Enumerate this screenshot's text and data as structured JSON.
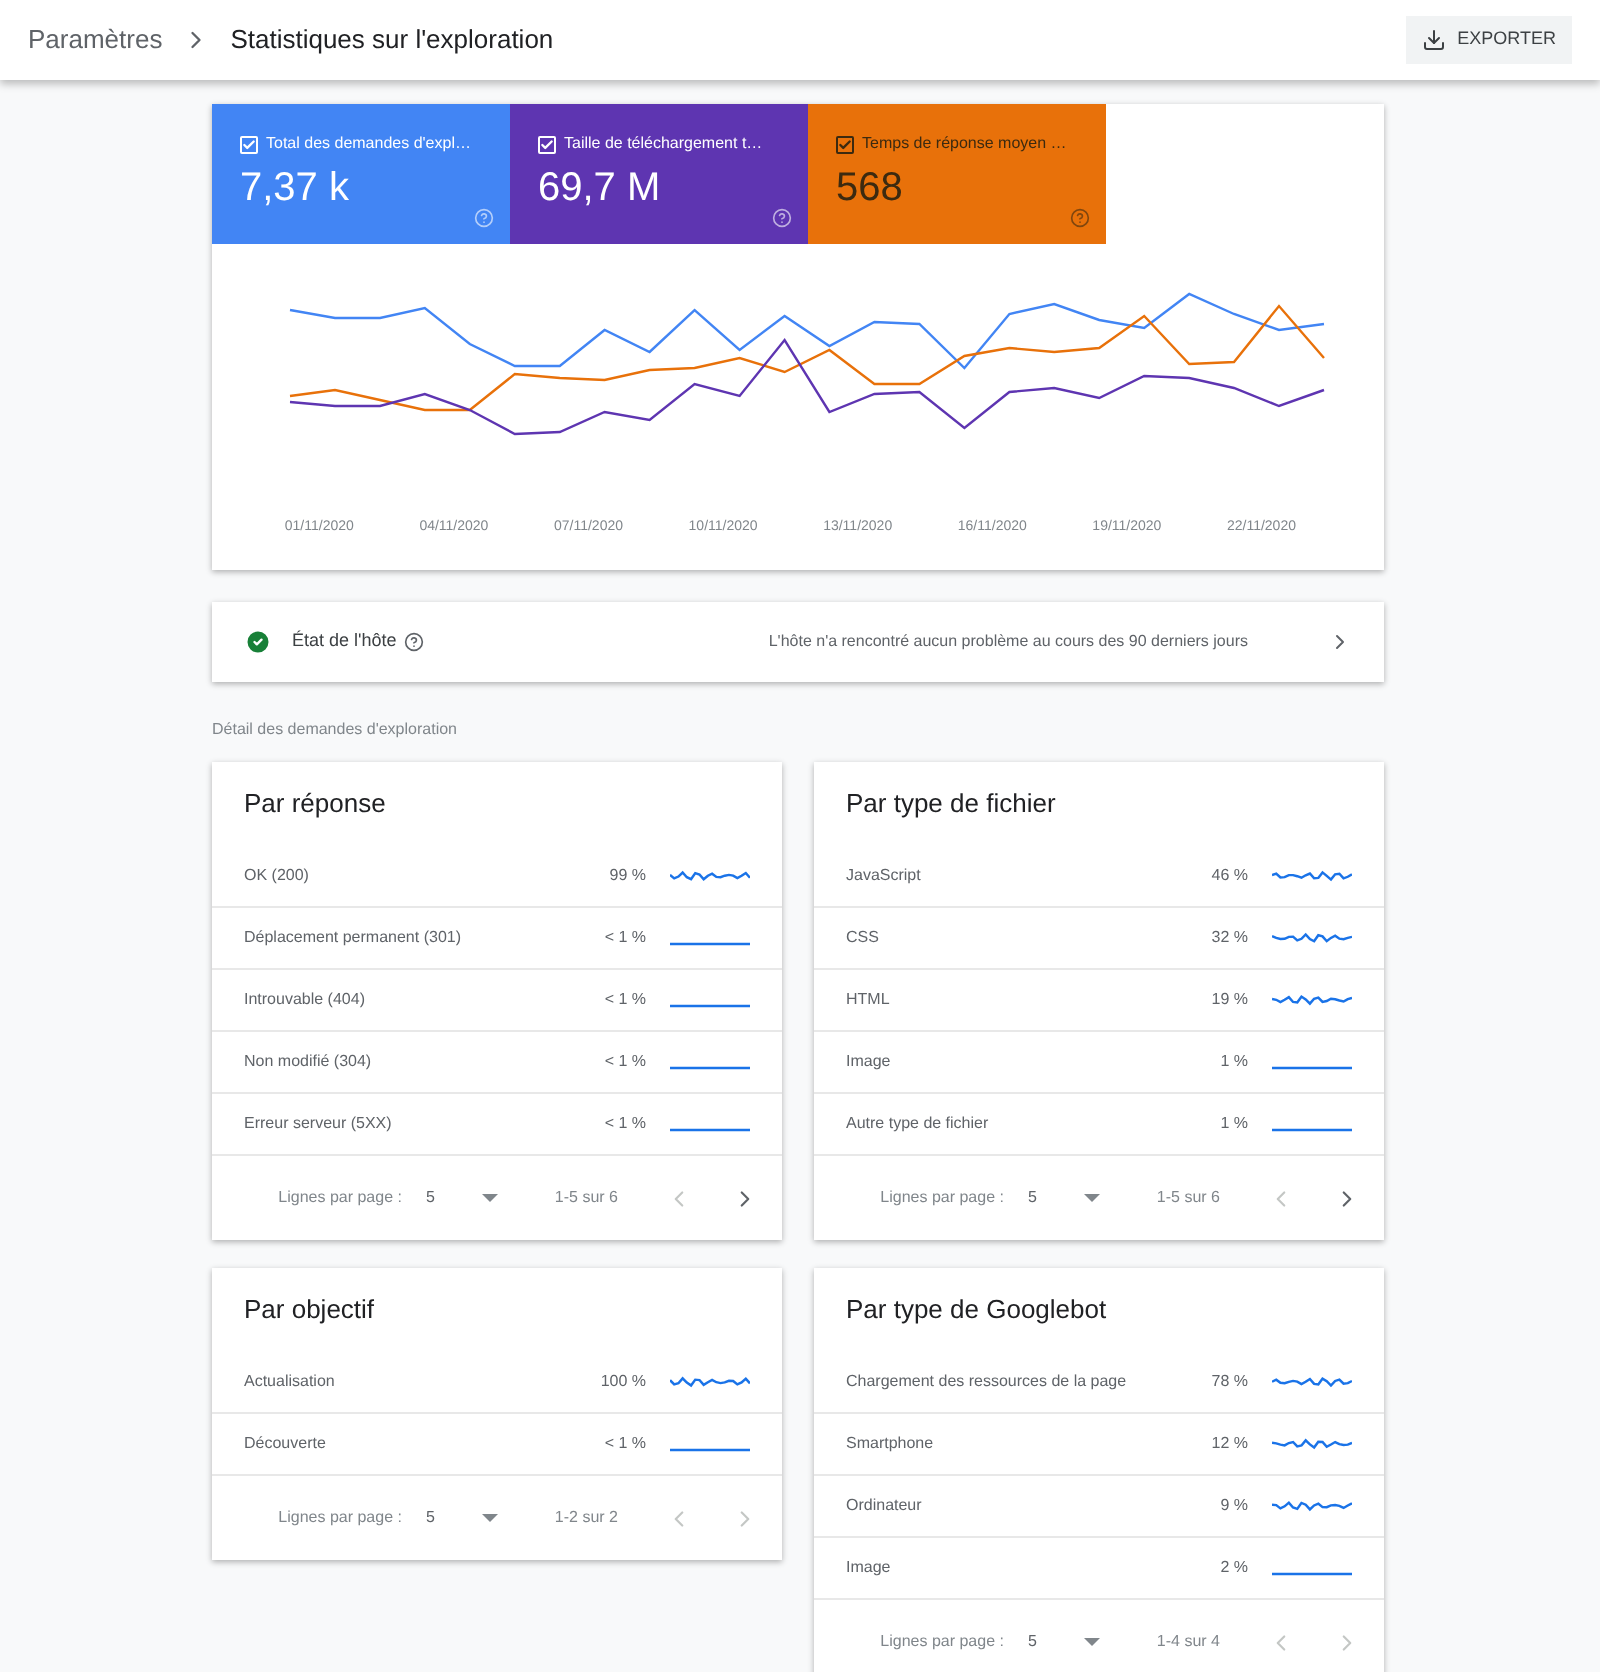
{
  "header": {
    "breadcrumb": "Paramètres",
    "title": "Statistiques sur l'exploration",
    "export_button": "EXPORTER"
  },
  "metrics": [
    {
      "label": "Total des demandes d'expl…",
      "value": "7,37 k",
      "checked": true,
      "color": "#4285f4"
    },
    {
      "label": "Taille de téléchargement t…",
      "value": "69,7 M",
      "checked": true,
      "color": "#5e35b1"
    },
    {
      "label": "Temps de réponse moyen …",
      "value": "568",
      "checked": true,
      "color": "#e8710a"
    }
  ],
  "chart": {
    "x_labels": [
      "01/11/2020",
      "04/11/2020",
      "07/11/2020",
      "10/11/2020",
      "13/11/2020",
      "16/11/2020",
      "19/11/2020",
      "22/11/2020"
    ]
  },
  "host_status": {
    "label": "État de l'hôte",
    "message": "L'hôte n'a rencontré aucun problème au cours des 90 derniers jours"
  },
  "section_label": "Détail des demandes d'exploration",
  "cards": [
    {
      "title": "Par réponse",
      "rows": [
        {
          "name": "OK (200)",
          "share": "99 %",
          "kind": "wavy"
        },
        {
          "name": "Déplacement permanent (301)",
          "share": "< 1 %",
          "kind": "flat"
        },
        {
          "name": "Introuvable (404)",
          "share": "< 1 %",
          "kind": "flat"
        },
        {
          "name": "Non modifié (304)",
          "share": "< 1 %",
          "kind": "flat"
        },
        {
          "name": "Erreur serveur (5XX)",
          "share": "< 1 %",
          "kind": "flat"
        }
      ],
      "rows_label": "Lignes par page :",
      "rows_per_page": "5",
      "range": "1-5 sur 6",
      "next_enabled": true
    },
    {
      "title": "Par type de fichier",
      "rows": [
        {
          "name": "JavaScript",
          "share": "46 %",
          "kind": "wavy"
        },
        {
          "name": "CSS",
          "share": "32 %",
          "kind": "wavy"
        },
        {
          "name": "HTML",
          "share": "19 %",
          "kind": "wavy"
        },
        {
          "name": "Image",
          "share": "1 %",
          "kind": "flat"
        },
        {
          "name": "Autre type de fichier",
          "share": "1 %",
          "kind": "flat"
        }
      ],
      "rows_label": "Lignes par page :",
      "rows_per_page": "5",
      "range": "1-5 sur 6",
      "next_enabled": true
    },
    {
      "title": "Par objectif",
      "rows": [
        {
          "name": "Actualisation",
          "share": "100 %",
          "kind": "wavy"
        },
        {
          "name": "Découverte",
          "share": "< 1 %",
          "kind": "flat"
        }
      ],
      "rows_label": "Lignes par page :",
      "rows_per_page": "5",
      "range": "1-2 sur 2",
      "next_enabled": false
    },
    {
      "title": "Par type de Googlebot",
      "rows": [
        {
          "name": "Chargement des ressources de la page",
          "share": "78 %",
          "kind": "wavy"
        },
        {
          "name": "Smartphone",
          "share": "12 %",
          "kind": "wavy"
        },
        {
          "name": "Ordinateur",
          "share": "9 %",
          "kind": "wavy"
        },
        {
          "name": "Image",
          "share": "2 %",
          "kind": "flat"
        }
      ],
      "rows_label": "Lignes par page :",
      "rows_per_page": "5",
      "range": "1-4 sur 4",
      "next_enabled": false
    }
  ]
}
